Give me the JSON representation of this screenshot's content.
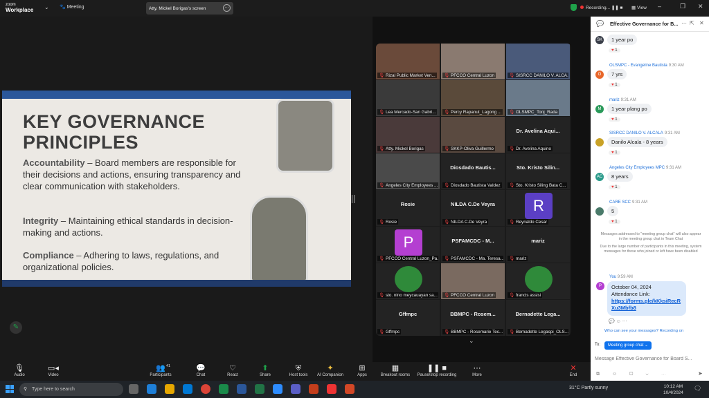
{
  "topbar": {
    "logo_line1": "zoom",
    "logo_line2": "Workplace",
    "meeting_label": "Meeting",
    "share_label": "Atty. Mickel Borigas's screen",
    "recording_label": "Recording...",
    "view_label": "View"
  },
  "slide": {
    "title": "KEY GOVERNANCE PRINCIPLES",
    "p1_heading": "Accountability",
    "p1_text": " – Board members are responsible for their decisions and actions, ensuring transparency and clear communication with stakeholders.",
    "p2_heading": "Integrity",
    "p2_text": " – Maintaining ethical standards in decision-making and actions.",
    "p3_heading": "Compliance",
    "p3_text": " – Adhering to laws, regulations, and organizational policies."
  },
  "gallery": {
    "tiles": [
      {
        "label": "Rizal Public Market Ven...",
        "bigname": ""
      },
      {
        "label": "PFCCO Central Luzon",
        "bigname": ""
      },
      {
        "label": "SISRCC DANILO V. ALCA...",
        "bigname": ""
      },
      {
        "label": "Lea Mercado-San Gabri...",
        "bigname": ""
      },
      {
        "label": "Percy Rapanut_Lagong ...",
        "bigname": ""
      },
      {
        "label": "OLSMPC_Tonj_Rada",
        "bigname": ""
      },
      {
        "label": "Atty. Mickel Borigas",
        "bigname": ""
      },
      {
        "label": "SKKP-Oliva Guillermo",
        "bigname": ""
      },
      {
        "label": "Dr. Avelina Aquino",
        "bigname": "Dr. Avelina Aqui..."
      },
      {
        "label": "Angeles City Employees ...",
        "bigname": ""
      },
      {
        "label": "Diosdado Bautista Valdez",
        "bigname": "Diosdado Bautis..."
      },
      {
        "label": "Sto. Kristo Siling Bata C...",
        "bigname": "Sto. Kristo Silin..."
      },
      {
        "label": "Rosie",
        "bigname": "Rosie"
      },
      {
        "label": "NILDA C.De Veyra",
        "bigname": "NILDA C.De Veyra"
      },
      {
        "label": "Reynaldo Cesar",
        "bigname": "",
        "avatar": "R"
      },
      {
        "label": "PFCCO Central Luzon_Pa...",
        "bigname": "",
        "avatar": "P"
      },
      {
        "label": "PSFAMCDC - Ma. Teresa...",
        "bigname": "PSFAMCDC - M..."
      },
      {
        "label": "mariz",
        "bigname": "mariz"
      },
      {
        "label": "sto. nino meycauayan sa...",
        "bigname": ""
      },
      {
        "label": "PFCCO Central Luzon",
        "bigname": ""
      },
      {
        "label": "francis assisi",
        "bigname": ""
      },
      {
        "label": "Gffmpc",
        "bigname": "Gffmpc"
      },
      {
        "label": "BBMPC - Rosemarie Tec...",
        "bigname": "BBMPC - Rosem..."
      },
      {
        "label": "Bernadette Legaspi_OLS...",
        "bigname": "Bernadette Lega..."
      }
    ]
  },
  "chat": {
    "title": "Effective Governance for B...",
    "messages": [
      {
        "avatar": "SK",
        "sender": "",
        "time": "",
        "text": "1 year po",
        "react": "1"
      },
      {
        "avatar": "O",
        "sender": "OLSMPC - Evangeline Bautista",
        "time": "9:30 AM",
        "text": "7 yrs",
        "react": "1"
      },
      {
        "avatar": "M",
        "sender": "mariz",
        "time": "9:31 AM",
        "text": "1 year plang po",
        "react": "1"
      },
      {
        "avatar": "",
        "sender": "SISRCC DANILO V. ALCALA",
        "time": "9:31 AM",
        "text": "Danilo Alcala - 8 years",
        "react": "1"
      },
      {
        "avatar": "AC",
        "sender": "Angeles City Employees MPC",
        "time": "9:31 AM",
        "text": "8 years",
        "react": "1"
      },
      {
        "avatar": "",
        "sender": "CARE SCC",
        "time": "9:31 AM",
        "text": "5",
        "react": "1"
      }
    ],
    "system_note1": "Messages addressed to \"meeting group chat\" will also appear in the meeting group chat in Team Chat",
    "system_note2": "Due to the large number of participants in this meeting, system messages for those who joined or left have been disabled",
    "you_label": "You",
    "you_time": "9:59 AM",
    "my_avatar": "P",
    "my_line1": "October 04, 2024",
    "my_line2": "Attendance Link:",
    "my_link": "https://forms.gle/kKksiRecRXu3Mbfb8",
    "who_can_see": "Who can see your messages? Recording on",
    "to_label": "To:",
    "to_target": "Meeting group chat",
    "input_placeholder": "Message Effective Governance for Board S..."
  },
  "toolbar": {
    "audio": "Audio",
    "video": "Video",
    "participants": "Participants",
    "participants_count": "41",
    "chat": "Chat",
    "react": "React",
    "share": "Share",
    "host_tools": "Host tools",
    "ai_companion": "AI Companion",
    "apps": "Apps",
    "breakout": "Breakout rooms",
    "pause_stop": "Pause/stop recording",
    "more": "More",
    "end": "End"
  },
  "taskbar": {
    "search_placeholder": "Type here to search",
    "weather": "31°C  Partly sunny",
    "time": "10:12 AM",
    "date": "10/4/2024"
  },
  "colors": {
    "accent": "#0e72ed",
    "recording_red": "#e33333",
    "security_green": "#1fa34a"
  }
}
